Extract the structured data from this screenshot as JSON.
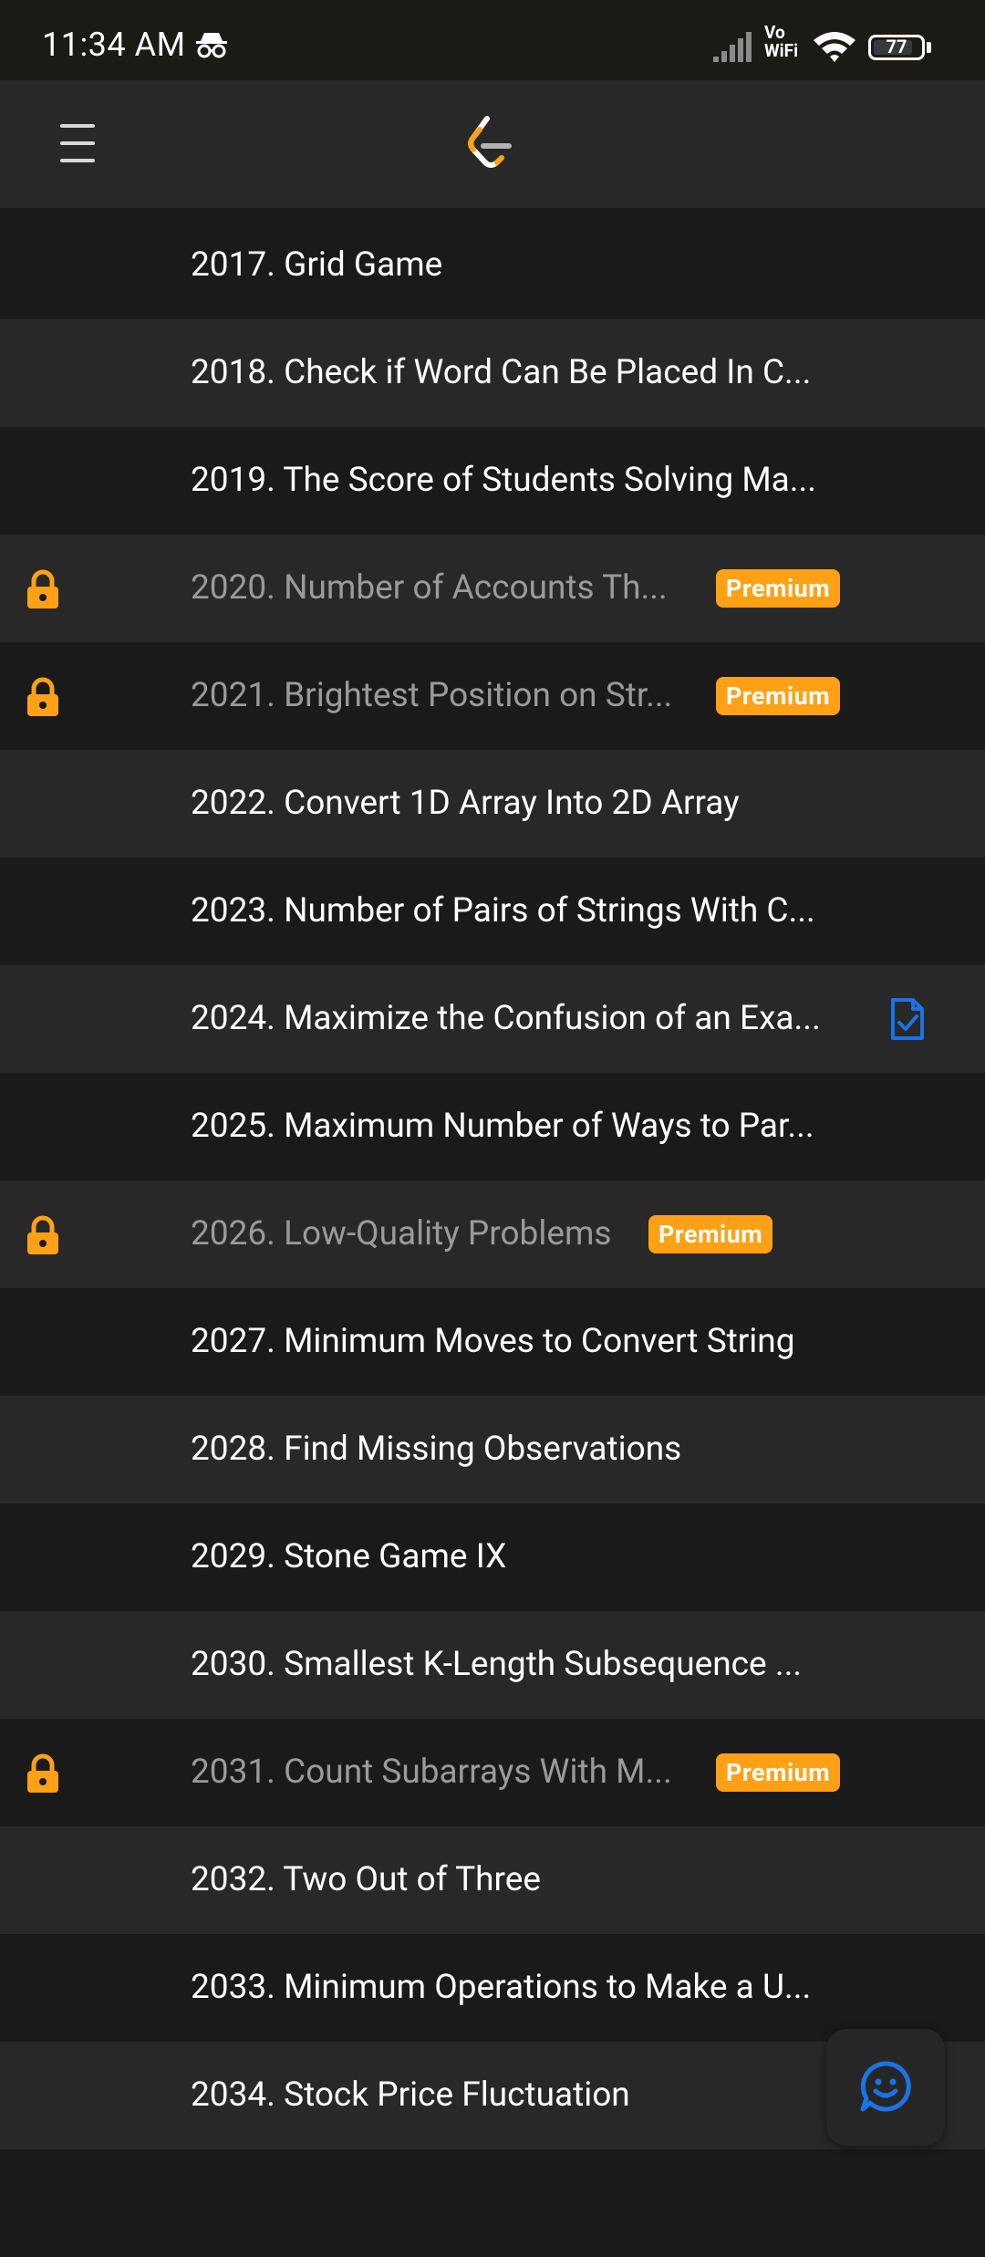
{
  "status": {
    "time": "11:34 AM",
    "network": "Vo WiFi",
    "battery": "77"
  },
  "colors": {
    "accent": "#ffa116",
    "premium_bg": "#ffa116",
    "solved_icon": "#1a73e8",
    "row_dark": "#1a1a1a",
    "row_light": "#282828"
  },
  "icons": {
    "menu": "hamburger-menu-icon",
    "logo": "leetcode-logo",
    "lock": "lock-icon",
    "solved": "solved-document-check-icon",
    "feedback": "smiley-chat-icon"
  },
  "problems": [
    {
      "title": "2017. Grid Game",
      "locked": false,
      "premium": false,
      "solved": false
    },
    {
      "title": "2018. Check if Word Can Be Placed In C...",
      "locked": false,
      "premium": false,
      "solved": false
    },
    {
      "title": "2019. The Score of Students Solving Ma...",
      "locked": false,
      "premium": false,
      "solved": false
    },
    {
      "title": "2020. Number of Accounts Th...",
      "locked": true,
      "premium": true,
      "solved": false
    },
    {
      "title": "2021. Brightest Position on Str...",
      "locked": true,
      "premium": true,
      "solved": false
    },
    {
      "title": "2022. Convert 1D Array Into 2D Array",
      "locked": false,
      "premium": false,
      "solved": false
    },
    {
      "title": "2023. Number of Pairs of Strings With C...",
      "locked": false,
      "premium": false,
      "solved": false
    },
    {
      "title": "2024. Maximize the Confusion of an Exa...",
      "locked": false,
      "premium": false,
      "solved": true
    },
    {
      "title": "2025. Maximum Number of Ways to Par...",
      "locked": false,
      "premium": false,
      "solved": false
    },
    {
      "title": "2026. Low-Quality Problems",
      "locked": true,
      "premium": true,
      "solved": false
    },
    {
      "title": "2027. Minimum Moves to Convert String",
      "locked": false,
      "premium": false,
      "solved": false
    },
    {
      "title": "2028. Find Missing Observations",
      "locked": false,
      "premium": false,
      "solved": false
    },
    {
      "title": "2029. Stone Game IX",
      "locked": false,
      "premium": false,
      "solved": false
    },
    {
      "title": "2030. Smallest K-Length Subsequence ...",
      "locked": false,
      "premium": false,
      "solved": false
    },
    {
      "title": "2031. Count Subarrays With M...",
      "locked": true,
      "premium": true,
      "solved": false
    },
    {
      "title": "2032. Two Out of Three",
      "locked": false,
      "premium": false,
      "solved": false
    },
    {
      "title": "2033. Minimum Operations to Make a U...",
      "locked": false,
      "premium": false,
      "solved": false
    },
    {
      "title": "2034. Stock Price Fluctuation",
      "locked": false,
      "premium": false,
      "solved": false
    },
    {
      "title": "",
      "locked": false,
      "premium": false,
      "solved": false
    }
  ],
  "premium_label": "Premium"
}
